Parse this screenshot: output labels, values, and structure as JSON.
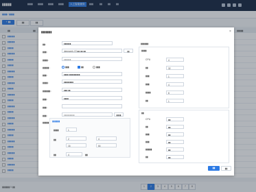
{
  "app": {
    "logo": "▮▮▮▮▮",
    "nav": [
      "▮▮▮▮",
      "▮▮▮▮",
      "▮▮▮▮",
      "▮▮▮▮",
      "人工智能服务",
      "▮▮▮",
      "▮▮",
      "▮▮",
      "▮▮"
    ]
  },
  "breadcrumb": "▮▮▮▮ / ▮▮▮▮",
  "toolbar": {
    "add_label": "+ ▮▮",
    "btn2": "▮▮",
    "btn3": "▮▮"
  },
  "table": {
    "headers": [
      "▮▮",
      "▮▮",
      "▮▮▮▮▮"
    ],
    "rows": [
      "▮▮▮▮▮▮",
      "▮▮▮▮▮▮",
      "▮▮▮▮▮",
      "▮▮▮▮▮▮",
      "▮▮▮▮▮",
      "▮▮▮▮▮",
      "▮▮▮▮▮▮",
      "▮▮▮▮▮",
      "▮▮▮▮▮▮",
      "▮▮▮▮▮",
      "▮▮▮▮▮▮",
      "▮▮▮▮▮",
      "▮▮▮▮▮▮",
      "▮▮▮▮▮",
      "▮▮▮▮▮▮",
      "▮▮▮▮▮",
      "▮▮▮▮▮▮",
      "▮▮▮▮▮",
      "▮▮▮▮▮▮",
      "▮▮▮▮▮",
      "▮▮▮▮▮▮",
      "▮▮▮▮▮",
      "▮▮▮▮▮▮",
      "▮▮▮▮▮"
    ]
  },
  "pager": {
    "total": "▮▮▮▮▮▮ 5 ▮▮",
    "pages": [
      "1",
      "2",
      "3",
      "4",
      "5",
      "6",
      "7",
      "8"
    ],
    "active_index": 1
  },
  "modal": {
    "title": "▮▮▮▮▮▮▮",
    "fields": {
      "name_label": "▮▮：",
      "name_value": "▮▮▮▮▮▮",
      "image_label": "▮▮▮：",
      "image_value": "deepseek-V3 ▮▮ ▮▮ ▮▮",
      "image_btn": "▮▮",
      "model_label": "▮▮▮▮：",
      "model_value": "▮▮▮▮▮▮",
      "deploy_label": "▮▮▮▮▮：",
      "deploy_opts": [
        "▮▮▮",
        "▮▮",
        "▮▮▮"
      ],
      "res_label": "▮▮▮：",
      "res_value": "▮▮▮▮ ▮▮▮▮▮▮▮▮▮",
      "cpu_label": "▮▮▮▮：",
      "cpu_value": "▮▮▮▮▮▮▮▮",
      "node_label": "▮▮▮▮▮▮：",
      "node_value": "▮▮▮ ▮▮",
      "port_label": "▮▮▮：",
      "port_value": "▮▮▮▮",
      "path_label": "▮▮▮：",
      "path_value": "",
      "env_label": "▮▮▮：",
      "env_value": "▮▮▮▮▮▮▮▮▮",
      "env_btn": "▮▮▮▮",
      "extra_label": "▮▮▮▮▮："
    },
    "section": {
      "title": "▮▮▮▮▮▮",
      "replicas_label": "▮▮▮▮",
      "replicas_value": "1",
      "cpu_label": "▮▮",
      "cpu_min": "2",
      "cpu_max": "4",
      "mem_min": "16",
      "mem_max": "64",
      "gpu_label": "▮▮",
      "gpu_value": "4",
      "gpu_unit": "▮▮"
    },
    "right": {
      "title": "▮▮▮▮▮▮",
      "panel1_title": "▮▮▮▮",
      "panel1_rows": [
        {
          "label": "CPU",
          "value": "4"
        },
        {
          "label": "▮▮",
          "value": "32"
        },
        {
          "label": "▮▮▮",
          "value": "1"
        },
        {
          "label": "▮▮▮",
          "value": "4"
        },
        {
          "label": "▮▮▮▮",
          "value": "8"
        },
        {
          "label": "▮▮",
          "value": "1"
        }
      ],
      "panel2_title": "▮▮",
      "panel2_rows": [
        {
          "label": "CPU",
          "value": "▮▮"
        },
        {
          "label": "▮▮",
          "value": "▮▮"
        },
        {
          "label": "▮▮▮",
          "value": "▮▮"
        },
        {
          "label": "▮▮▮",
          "value": "▮▮"
        },
        {
          "label": "▮▮▮▮▮",
          "value": "▮▮"
        },
        {
          "label": "▮▮",
          "value": "▮▮"
        }
      ]
    },
    "ok_label": "▮▮",
    "cancel_label": "▮▮"
  }
}
